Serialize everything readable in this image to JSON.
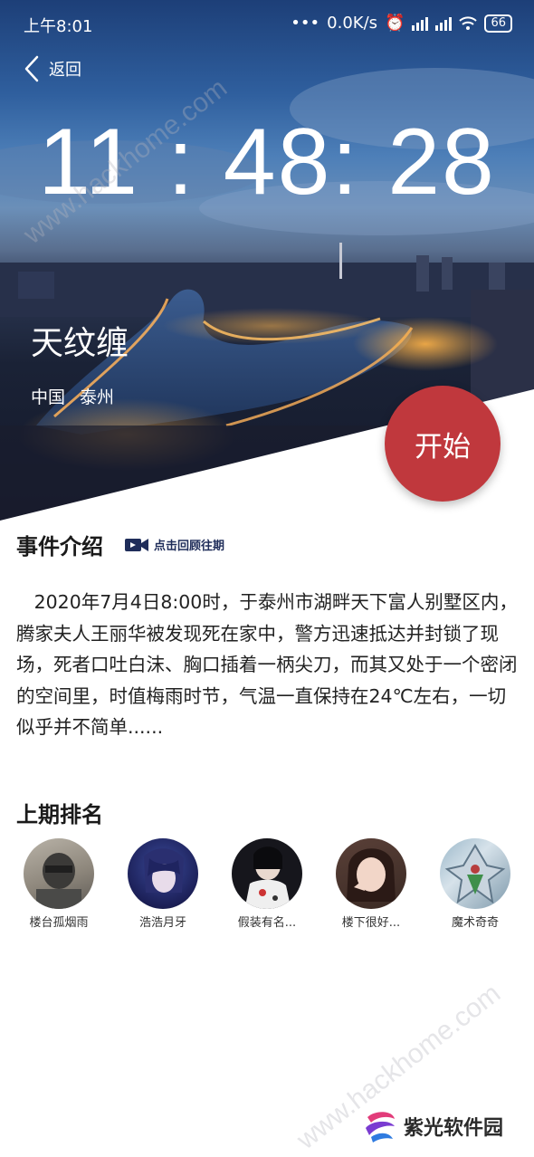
{
  "status_bar": {
    "time": "上午8:01",
    "network_speed": "0.0K/s",
    "battery": "66"
  },
  "header": {
    "back_label": "返回"
  },
  "countdown": {
    "time": "11 : 48: 28"
  },
  "case": {
    "title": "天纹缠",
    "country": "中国",
    "city": "泰州",
    "start_label": "开始"
  },
  "intro": {
    "heading": "事件介绍",
    "replay_label": "点击回顾往期",
    "text": "2020年7月4日8:00时，于泰州市湖畔天下富人别墅区内，腾家夫人王丽华被发现死在家中，警方迅速抵达并封锁了现场，死者口吐白沫、胸口插着一柄尖刀，而其又处于一个密闭的空间里，时值梅雨时节，气温一直保持在24℃左右，一切似乎并不简单......"
  },
  "ranking": {
    "heading": "上期排名",
    "players": [
      {
        "name": "楼台孤烟雨"
      },
      {
        "name": "浩浩月牙"
      },
      {
        "name": "假装有名..."
      },
      {
        "name": "楼下很好..."
      },
      {
        "name": "魔术奇奇"
      }
    ]
  },
  "watermark": "www.hackhome.com",
  "brand": "紫光软件园",
  "colors": {
    "accent": "#c0383d",
    "replay_icon": "#1f2d5a"
  }
}
